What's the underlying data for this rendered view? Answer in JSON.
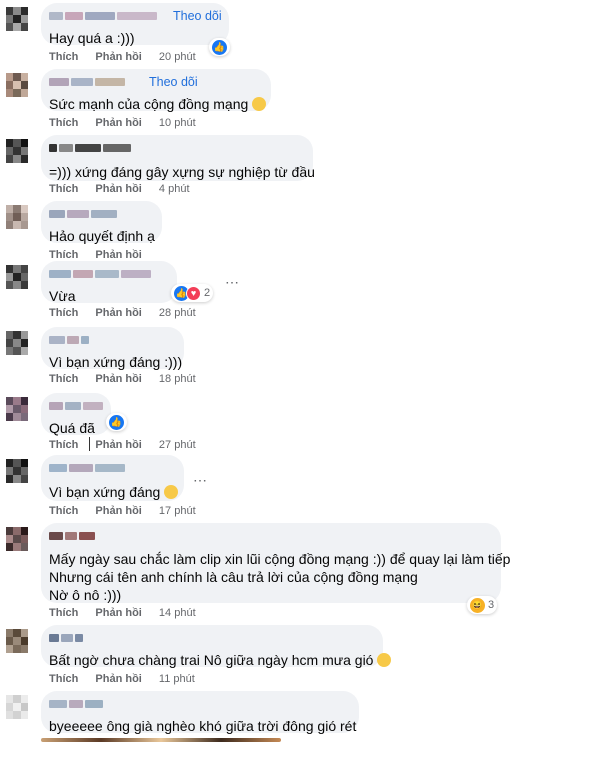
{
  "comments": [
    {
      "text": "Hay quá a :)))",
      "follow": "Theo dõi",
      "actions": [
        "Thích",
        "Phản hồi"
      ],
      "time": "20 phút"
    },
    {
      "text": "Sức mạnh của cộng đồng mạng",
      "follow": "Theo dõi",
      "actions": [
        "Thích",
        "Phản hồi"
      ],
      "time": "10 phút"
    },
    {
      "text": "=))) xứng đáng gây xựng sự nghiệp từ đầu",
      "actions": [
        "Thích",
        "Phản hồi"
      ],
      "time": "4 phút"
    },
    {
      "text": "Hảo quyết định ạ",
      "actions": [
        "Thích",
        "Phản hồi"
      ],
      "time": ""
    },
    {
      "text": "Vừa",
      "actions": [
        "Thích",
        "Phản hồi"
      ],
      "time": "28 phút",
      "reaction_count": "2"
    },
    {
      "text": "Vì bạn xứng đáng :)))",
      "actions": [
        "Thích",
        "Phản hồi"
      ],
      "time": "18 phút"
    },
    {
      "text": "Quá đã",
      "actions": [
        "Thích",
        "Phản hồi"
      ],
      "time": "27 phút"
    },
    {
      "text": "Vì bạn xứng đáng",
      "actions": [
        "Thích",
        "Phản hồi"
      ],
      "time": "17 phút"
    },
    {
      "lines": [
        "Mấy ngày sau chắc làm clip xin lũi cộng đồng mạng :)) để quay lại làm tiếp",
        "Nhưng cái tên anh chính là câu trả lời của cộng đồng mạng",
        "Nờ ô nô :)))"
      ],
      "actions": [
        "Thích",
        "Phản hồi"
      ],
      "time": "14 phút",
      "reaction_count": "3"
    },
    {
      "text": "Bất ngờ chưa chàng trai Nô giữa ngày hcm mưa gió",
      "actions": [
        "Thích",
        "Phản hồi"
      ],
      "time": "11 phút"
    },
    {
      "text": "byeeeee ông già nghèo khó giữa trời đông gió rét"
    }
  ],
  "icons": {
    "like": "like-icon",
    "love": "love-icon",
    "haha": "haha-icon",
    "more": "more-options-icon"
  }
}
